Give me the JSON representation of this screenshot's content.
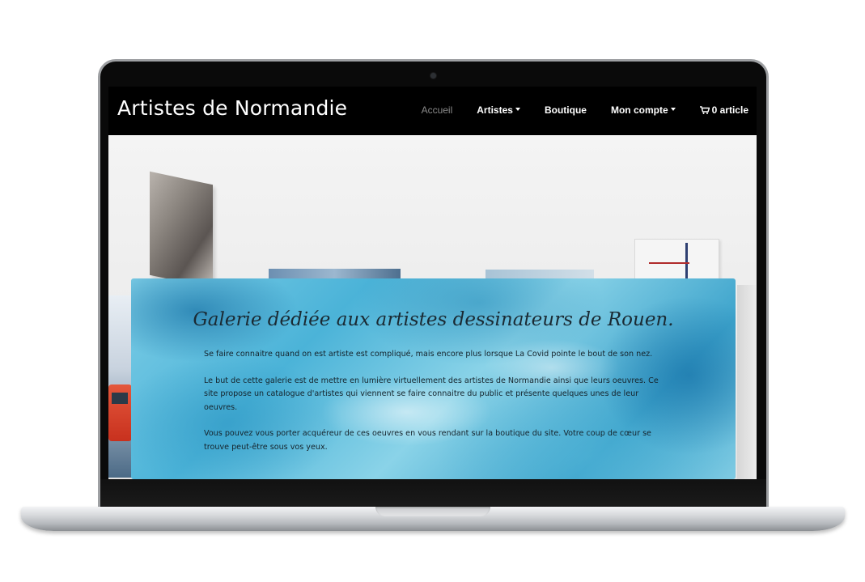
{
  "site": {
    "brand": "Artistes de Normandie"
  },
  "nav": {
    "items": [
      {
        "label": "Accueil",
        "active": true,
        "dropdown": false
      },
      {
        "label": "Artistes",
        "active": false,
        "dropdown": true
      },
      {
        "label": "Boutique",
        "active": false,
        "dropdown": false
      },
      {
        "label": "Mon compte",
        "active": false,
        "dropdown": true
      }
    ],
    "cart_label": "0 article",
    "cart_icon": "cart-icon"
  },
  "hero": {
    "title": "Galerie dédiée aux artistes dessinateurs de Rouen.",
    "paragraphs": [
      "Se faire connaitre quand on est artiste est compliqué, mais encore plus lorsque La Covid pointe le bout de son nez.",
      "Le but de cette galerie est de mettre en lumière virtuellement des artistes de Normandie ainsi que leurs oeuvres. Ce site propose un catalogue d'artistes qui viennent se faire connaitre du public et présente quelques unes de leur oeuvres.",
      "Vous pouvez vous porter acquéreur de ces oeuvres en vous rendant sur la boutique du site. Votre coup de cœur se trouve peut-être sous vos yeux."
    ]
  },
  "colors": {
    "navbar_bg": "#000000",
    "nav_active": "#8a8a8a",
    "nav_text": "#ffffff",
    "card_watercolor": "#4bb3d8"
  }
}
